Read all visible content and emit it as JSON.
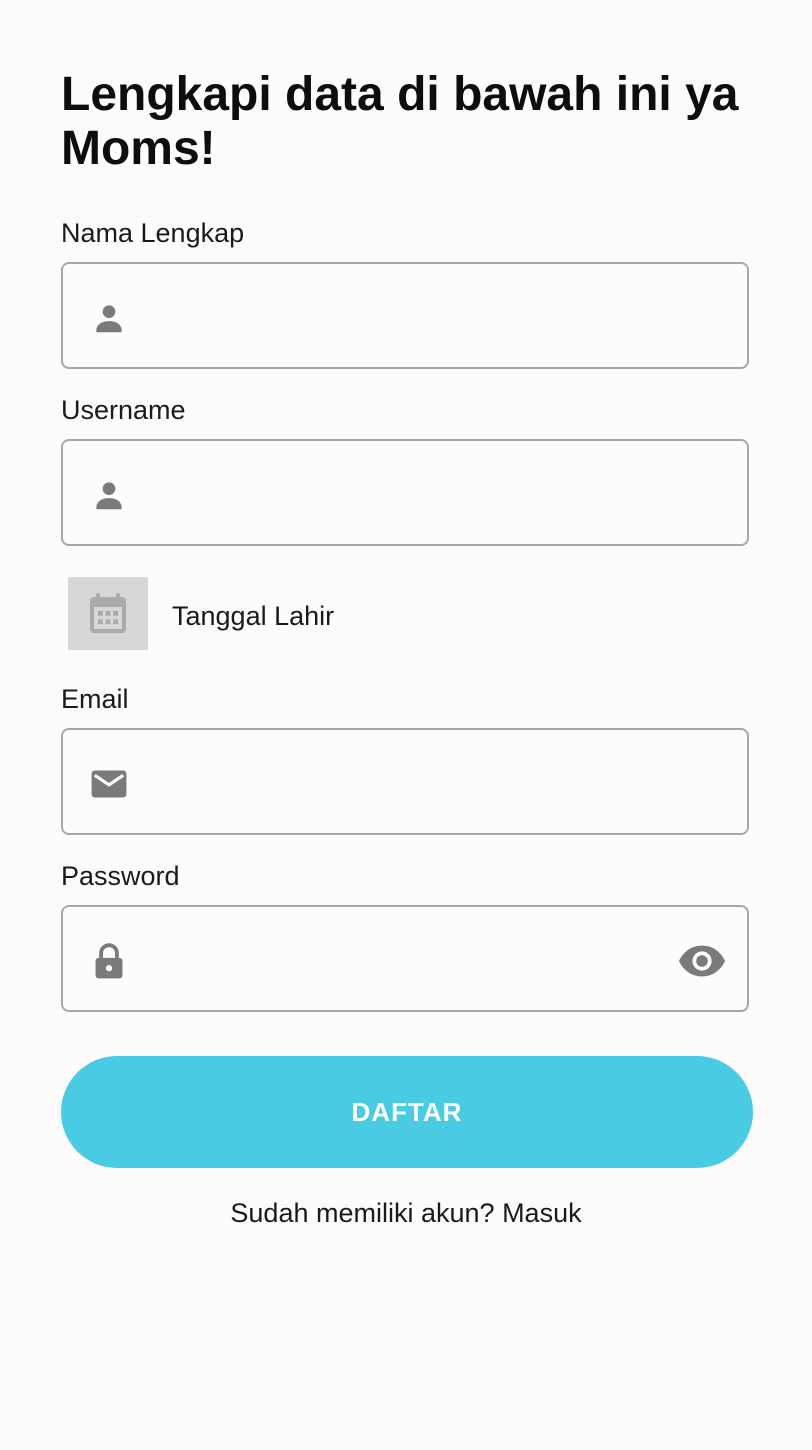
{
  "header": {
    "title": "Lengkapi data di bawah ini ya Moms!"
  },
  "form": {
    "full_name": {
      "label": "Nama Lengkap",
      "value": "",
      "icon": "person-icon"
    },
    "username": {
      "label": "Username",
      "value": "",
      "icon": "person-icon"
    },
    "birth_date": {
      "label": "Tanggal Lahir",
      "icon": "calendar-icon"
    },
    "email": {
      "label": "Email",
      "value": "",
      "icon": "mail-icon"
    },
    "password": {
      "label": "Password",
      "value": "",
      "icon": "lock-icon",
      "toggle_icon": "eye-icon"
    }
  },
  "actions": {
    "submit_label": "DAFTAR",
    "login_prompt": "Sudah memiliki akun?",
    "login_link": "Masuk"
  },
  "colors": {
    "accent": "#48cbe3",
    "icon": "#7a797c",
    "border": "#a7a7a9",
    "date_button_bg": "#d6d7d6",
    "background": "#fefbfd"
  }
}
